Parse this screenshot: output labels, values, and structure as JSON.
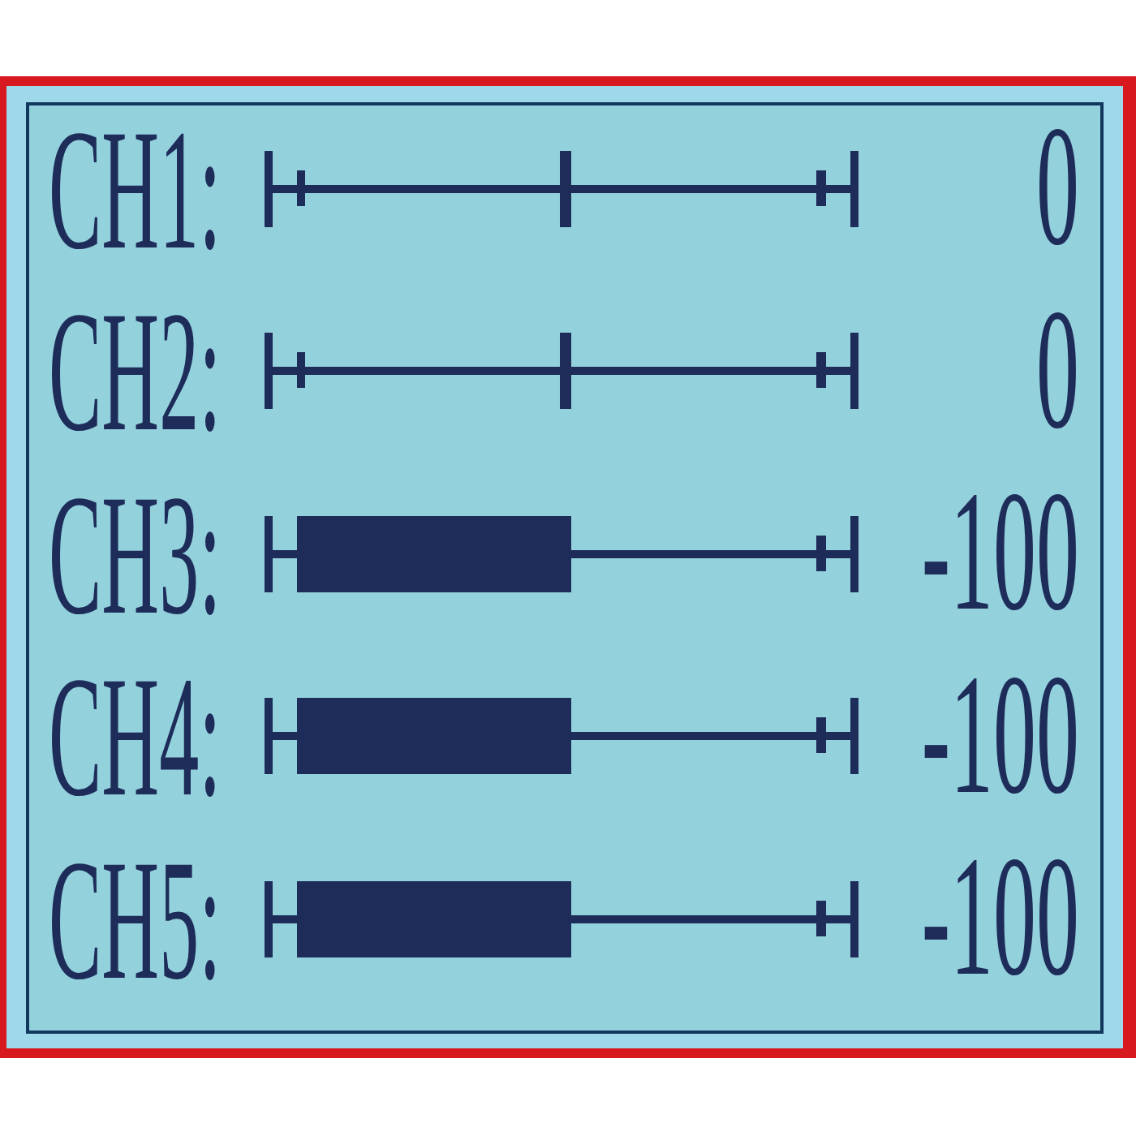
{
  "channels": [
    {
      "label": "CH1:",
      "level": 0,
      "reading": "0"
    },
    {
      "label": "CH2:",
      "level": 0,
      "reading": "0"
    },
    {
      "label": "CH3:",
      "level": 0.5,
      "reading": "-100"
    },
    {
      "label": "CH4:",
      "level": 0.5,
      "reading": "-100"
    },
    {
      "label": "CH5:",
      "level": 0.5,
      "reading": "-100"
    }
  ]
}
